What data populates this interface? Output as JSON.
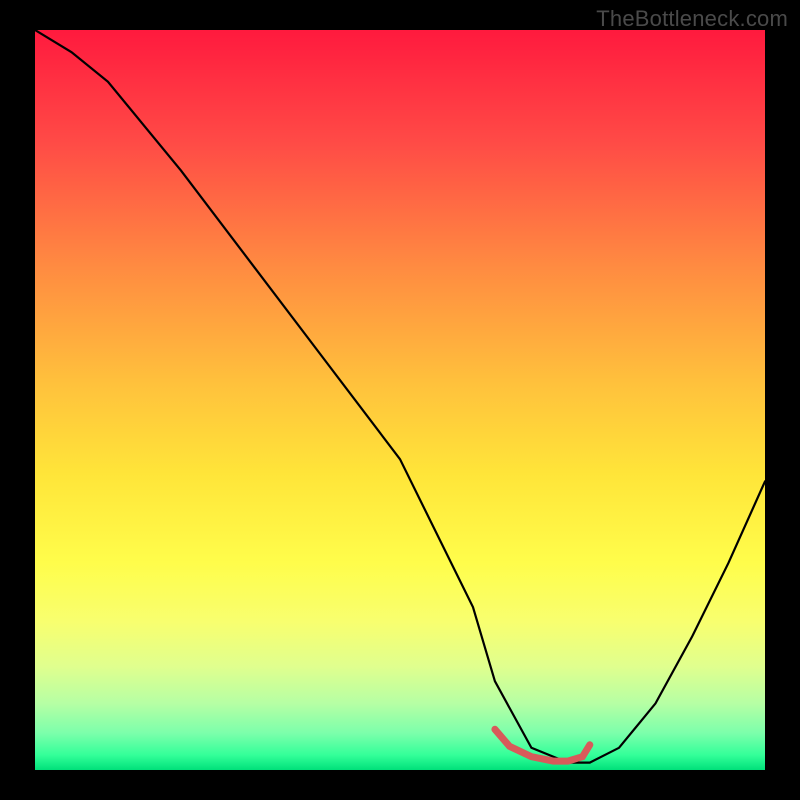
{
  "watermark": "TheBottleneck.com",
  "chart_data": {
    "type": "line",
    "title": "",
    "xlabel": "",
    "ylabel": "",
    "xlim": [
      0,
      100
    ],
    "ylim": [
      0,
      100
    ],
    "series": [
      {
        "name": "bottleneck-curve",
        "x": [
          0,
          5,
          10,
          20,
          30,
          40,
          50,
          60,
          63,
          68,
          73,
          76,
          80,
          85,
          90,
          95,
          100
        ],
        "values": [
          100,
          97,
          93,
          81,
          68,
          55,
          42,
          22,
          12,
          3,
          1,
          1,
          3,
          9,
          18,
          28,
          39
        ]
      }
    ],
    "highlight_segment": {
      "name": "optimal-range",
      "x": [
        63,
        65,
        68,
        71,
        73,
        75,
        76
      ],
      "values": [
        5.5,
        3.2,
        1.8,
        1.2,
        1.2,
        1.8,
        3.4
      ]
    },
    "gradient_meaning": "red = high bottleneck, green = optimal"
  }
}
